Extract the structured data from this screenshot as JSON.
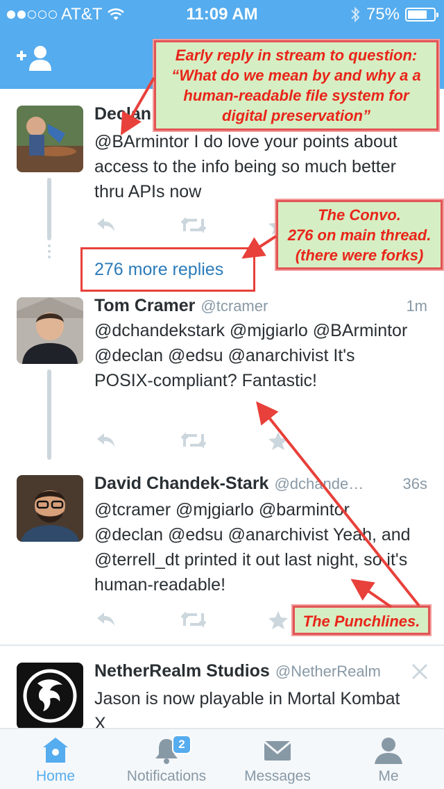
{
  "status_bar": {
    "carrier": "AT&T",
    "time": "11:09 AM",
    "battery": "75%",
    "battery_level": 0.75,
    "signal_bars_filled": 2,
    "signal_bars_total": 5
  },
  "tweets": [
    {
      "name": "Declan",
      "handle": "",
      "time": "",
      "text": "@BArmintor I do love your points about access to the info being so much better thru APIs now",
      "avatar_icon": "photo-avatar"
    },
    {
      "name": "Tom Cramer",
      "handle": "@tcramer",
      "time": "1m",
      "text": "@dchandekstark @mjgiarlo @BArmintor @declan @edsu @anarchivist It's POSIX-compliant? Fantastic!",
      "avatar_icon": "photo-avatar"
    },
    {
      "name": "David Chandek-Stark",
      "handle": "@dchande…",
      "time": "36s",
      "text": "@tcramer @mjgiarlo @barmintor @declan @edsu @anarchivist Yeah, and @terrell_dt printed it out last night, so it's human-readable!",
      "avatar_icon": "photo-avatar"
    },
    {
      "name": "NetherRealm Studios",
      "handle": "@NetherRealm",
      "time": "",
      "text": "Jason is now playable in Mortal Kombat X",
      "avatar_icon": "dragon-logo"
    }
  ],
  "more_replies": "276 more replies",
  "annotations": {
    "early_reply": "Early reply in stream to question: “What do we mean by and why a a human-readable file system for digital preservation”",
    "convo_title": "The Convo.",
    "convo_line2": "276 on main thread.",
    "convo_line3": "(there were forks)",
    "punchlines": "The Punchlines."
  },
  "tabs": [
    {
      "label": "Home",
      "icon": "home-icon",
      "active": true
    },
    {
      "label": "Notifications",
      "icon": "bell-icon",
      "badge": "2"
    },
    {
      "label": "Messages",
      "icon": "envelope-icon"
    },
    {
      "label": "Me",
      "icon": "person-icon"
    }
  ],
  "colors": {
    "brand": "#55acee",
    "annotation_text": "#e8251a",
    "annotation_bg": "#d6eec3",
    "annotation_border": "#e8403a"
  }
}
